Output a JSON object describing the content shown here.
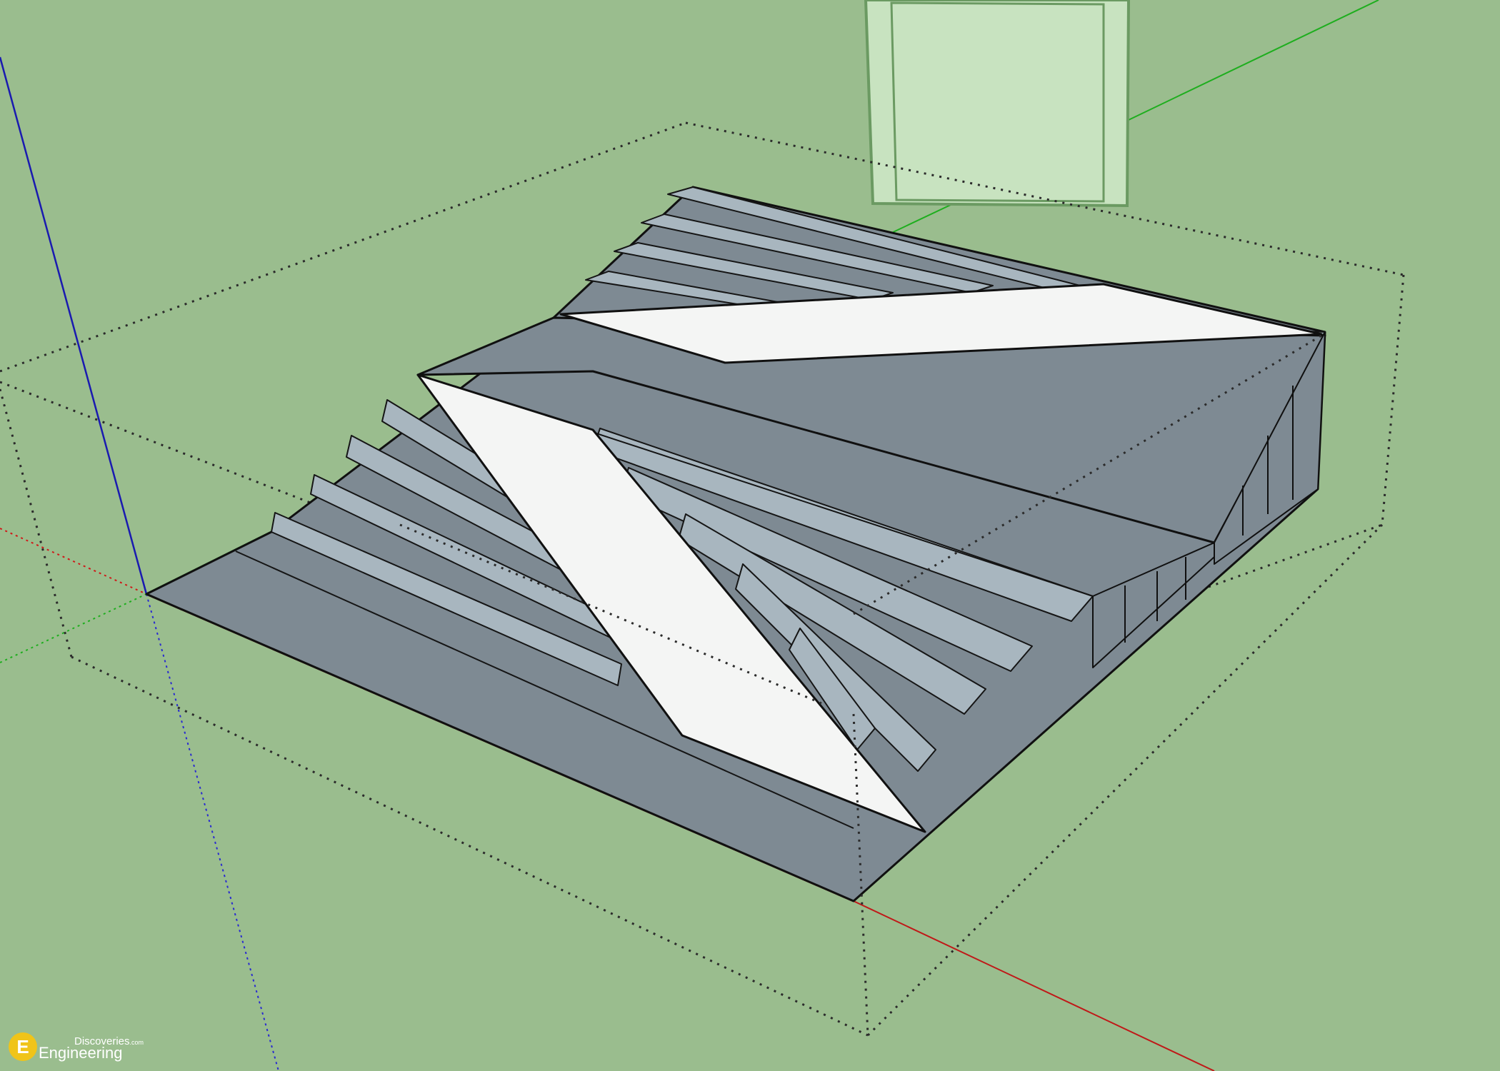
{
  "scene": {
    "background": "#9abd8e",
    "model_fill": "#7e8a93",
    "tread_fill": "#a8b6bf",
    "ramp_fill": "#f4f5f4",
    "panel_fill": "#c8e3c0",
    "axis_red": "#b01818",
    "axis_green": "#1eae1e",
    "axis_blue": "#1a1ab0"
  },
  "watermark": {
    "logo_letter": "E",
    "line1": "Discoveries",
    "line1_suffix": ".com",
    "line2": "Engineering"
  }
}
